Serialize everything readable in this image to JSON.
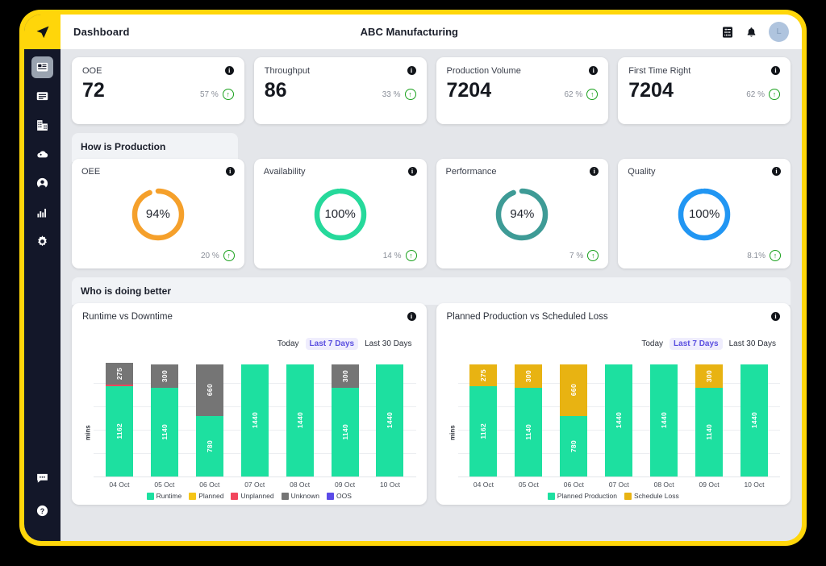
{
  "colors": {
    "frame": "#FFD60A",
    "sidebar": "#131729",
    "runtime": "#1DE0A0",
    "planned": "#F5C518",
    "unplanned": "#F2465C",
    "unknown": "#757575",
    "oos": "#5B4BE8",
    "schedule_loss": "#E8B312",
    "oee_ring": "#F5A02B",
    "availability_ring": "#26D99B",
    "performance_ring": "#3E9B96",
    "quality_ring": "#2196F3",
    "accent_tab": "#5A4FE0",
    "up_arrow": "#18A01B"
  },
  "sidebar": {
    "logo_icon": "navigation-arrow-icon",
    "items": [
      {
        "icon": "dashboard-icon",
        "name": "sidebar-item-dashboard",
        "active": true
      },
      {
        "icon": "monitor-icon",
        "name": "sidebar-item-monitor",
        "active": false
      },
      {
        "icon": "factory-icon",
        "name": "sidebar-item-plant",
        "active": false
      },
      {
        "icon": "cloud-icon",
        "name": "sidebar-item-cloud",
        "active": false
      },
      {
        "icon": "user-icon",
        "name": "sidebar-item-user",
        "active": false
      },
      {
        "icon": "bar-chart-icon",
        "name": "sidebar-item-analytics",
        "active": false
      },
      {
        "icon": "gear-icon",
        "name": "sidebar-item-settings",
        "active": false
      }
    ],
    "bottom_items": [
      {
        "icon": "chat-bubble-icon",
        "name": "sidebar-item-chat"
      },
      {
        "icon": "help-circle-icon",
        "name": "sidebar-item-help"
      }
    ]
  },
  "topbar": {
    "title": "Dashboard",
    "company": "ABC Manufacturing",
    "filter_icon": "sliders-icon",
    "bell_icon": "bell-icon",
    "avatar_initial": "L"
  },
  "kpis": [
    {
      "label": "OOE",
      "value": "72",
      "pct": "57 %",
      "trend": "up"
    },
    {
      "label": "Throughput",
      "value": "86",
      "pct": "33 %",
      "trend": "up"
    },
    {
      "label": "Production Volume",
      "value": "7204",
      "pct": "62 %",
      "trend": "up"
    },
    {
      "label": "First Time Right",
      "value": "7204",
      "pct": "62 %",
      "trend": "up"
    }
  ],
  "production_section": {
    "title": "How is Production",
    "gauges": [
      {
        "label": "OEE",
        "value": "94%",
        "percent": 94,
        "color": "#F5A02B",
        "pct": "20 %",
        "trend": "up"
      },
      {
        "label": "Availability",
        "value": "100%",
        "percent": 100,
        "color": "#26D99B",
        "pct": "14 %",
        "trend": "up"
      },
      {
        "label": "Performance",
        "value": "94%",
        "percent": 94,
        "color": "#3E9B96",
        "pct": "7 %",
        "trend": "up"
      },
      {
        "label": "Quality",
        "value": "100%",
        "percent": 100,
        "color": "#2196F3",
        "pct": "8.1%",
        "trend": "up"
      }
    ]
  },
  "comparison_section": {
    "title": "Who is doing better",
    "range_tabs": [
      "Today",
      "Last 7 Days",
      "Last 30 Days"
    ],
    "active_range": "Last 7 Days"
  },
  "chart_data": [
    {
      "type": "bar",
      "stacked": true,
      "title": "Runtime vs Downtime",
      "xlabel": "",
      "ylabel": "mins",
      "ylim": [
        0,
        1500
      ],
      "grid": true,
      "legend_position": "bottom",
      "categories": [
        "04 Oct",
        "05 Oct",
        "06 Oct",
        "07 Oct",
        "08 Oct",
        "09 Oct",
        "10 Oct"
      ],
      "series": [
        {
          "name": "Runtime",
          "color": "#1DE0A0",
          "values": [
            1162,
            1140,
            780,
            1440,
            1440,
            1140,
            1440
          ]
        },
        {
          "name": "Planned",
          "color": "#F5C518",
          "values": [
            0,
            0,
            0,
            0,
            0,
            0,
            0
          ]
        },
        {
          "name": "Unplanned",
          "color": "#F2465C",
          "values": [
            18,
            0,
            0,
            0,
            0,
            0,
            0
          ]
        },
        {
          "name": "Unknown",
          "color": "#757575",
          "values": [
            275,
            300,
            660,
            0,
            0,
            300,
            0
          ]
        },
        {
          "name": "OOS",
          "color": "#5B4BE8",
          "values": [
            0,
            0,
            0,
            0,
            0,
            0,
            0
          ]
        }
      ],
      "bar_labels": [
        [
          {
            "text": "1162",
            "series": "Runtime"
          },
          {
            "text": "275",
            "series": "Unknown"
          }
        ],
        [
          {
            "text": "1140",
            "series": "Runtime"
          },
          {
            "text": "300",
            "series": "Unknown"
          }
        ],
        [
          {
            "text": "780",
            "series": "Runtime"
          },
          {
            "text": "660",
            "series": "Unknown"
          }
        ],
        [
          {
            "text": "1440",
            "series": "Runtime"
          }
        ],
        [
          {
            "text": "1440",
            "series": "Runtime"
          }
        ],
        [
          {
            "text": "1140",
            "series": "Runtime"
          },
          {
            "text": "300",
            "series": "Unknown"
          }
        ],
        [
          {
            "text": "1440",
            "series": "Runtime"
          }
        ]
      ]
    },
    {
      "type": "bar",
      "stacked": true,
      "title": "Planned Production vs Scheduled Loss",
      "xlabel": "",
      "ylabel": "mins",
      "ylim": [
        0,
        1500
      ],
      "grid": true,
      "legend_position": "bottom",
      "categories": [
        "04 Oct",
        "05 Oct",
        "06 Oct",
        "07 Oct",
        "08 Oct",
        "09 Oct",
        "10 Oct"
      ],
      "series": [
        {
          "name": "Planned Production",
          "color": "#1DE0A0",
          "values": [
            1162,
            1140,
            780,
            1440,
            1440,
            1140,
            1440
          ]
        },
        {
          "name": "Schedule Loss",
          "color": "#E8B312",
          "values": [
            275,
            300,
            660,
            0,
            0,
            300,
            0
          ]
        }
      ],
      "bar_labels": [
        [
          {
            "text": "1162",
            "series": "Planned Production"
          },
          {
            "text": "275",
            "series": "Schedule Loss"
          }
        ],
        [
          {
            "text": "1140",
            "series": "Planned Production"
          },
          {
            "text": "300",
            "series": "Schedule Loss"
          }
        ],
        [
          {
            "text": "780",
            "series": "Planned Production"
          },
          {
            "text": "660",
            "series": "Schedule Loss"
          }
        ],
        [
          {
            "text": "1440",
            "series": "Planned Production"
          }
        ],
        [
          {
            "text": "1440",
            "series": "Planned Production"
          }
        ],
        [
          {
            "text": "1140",
            "series": "Planned Production"
          },
          {
            "text": "300",
            "series": "Schedule Loss"
          }
        ],
        [
          {
            "text": "1440",
            "series": "Planned Production"
          }
        ]
      ]
    }
  ]
}
